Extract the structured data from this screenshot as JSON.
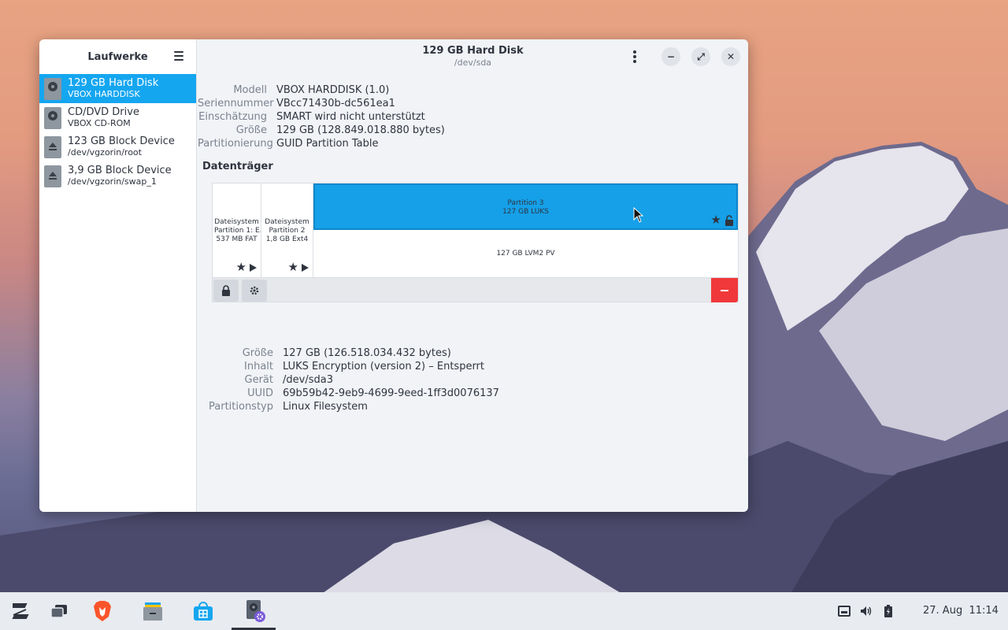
{
  "sidebar": {
    "title": "Laufwerke",
    "drives": [
      {
        "title": "129 GB Hard Disk",
        "sub": "VBOX HARDDISK",
        "icon": "hard-disk-icon"
      },
      {
        "title": "CD/DVD Drive",
        "sub": "VBOX CD-ROM",
        "icon": "optical-drive-icon"
      },
      {
        "title": "123 GB Block Device",
        "sub": "/dev/vgzorin/root",
        "icon": "block-device-icon"
      },
      {
        "title": "3,9 GB Block Device",
        "sub": "/dev/vgzorin/swap_1",
        "icon": "block-device-icon"
      }
    ]
  },
  "window": {
    "title": "129 GB Hard Disk",
    "subtitle": "/dev/sda",
    "minimize": "−",
    "maximize": "⤢",
    "close": "✕"
  },
  "disk_info": [
    {
      "label": "Modell",
      "value": "VBOX HARDDISK (1.0)"
    },
    {
      "label": "Seriennummer",
      "value": "VBcc71430b-dc561ea1"
    },
    {
      "label": "Einschätzung",
      "value": "SMART wird nicht unterstützt"
    },
    {
      "label": "Größe",
      "value": "129 GB (128.849.018.880 bytes)"
    },
    {
      "label": "Partitionierung",
      "value": "GUID Partition Table"
    }
  ],
  "volumes": {
    "title": "Datenträger",
    "partitions": [
      {
        "line1": "Dateisystem",
        "line2": "Partition 1: E...",
        "line3": "537 MB FAT"
      },
      {
        "line1": "Dateisystem",
        "line2": "Partition 2",
        "line3": "1,8 GB Ext4"
      },
      {
        "line1": "Partition 3",
        "line2": "127 GB LUKS"
      }
    ],
    "lvm": "127 GB LVM2 PV"
  },
  "partition_details": [
    {
      "label": "Größe",
      "value": "127 GB (126.518.034.432 bytes)"
    },
    {
      "label": "Inhalt",
      "value": "LUKS Encryption (version 2) – Entsperrt"
    },
    {
      "label": "Gerät",
      "value": "/dev/sda3"
    },
    {
      "label": "UUID",
      "value": "69b59b42-9eb9-4699-9eed-1ff3d0076137"
    },
    {
      "label": "Partitionstyp",
      "value": "Linux Filesystem"
    }
  ],
  "taskbar": {
    "apps": [
      "zorin-menu-icon",
      "workspaces-icon",
      "brave-browser-icon",
      "files-icon",
      "software-store-icon",
      "disks-icon"
    ],
    "tray": [
      "network-icon",
      "volume-icon",
      "battery-icon"
    ],
    "clock": "27. Aug  11:14"
  },
  "colors": {
    "accent": "#15a6f0",
    "danger": "#f0383a"
  }
}
